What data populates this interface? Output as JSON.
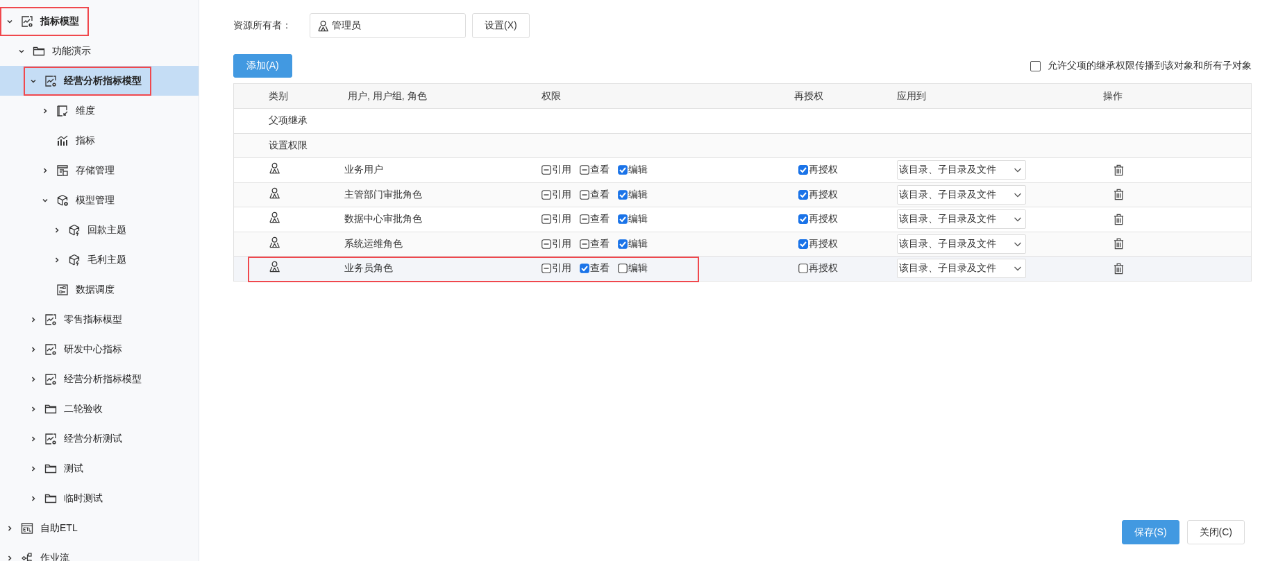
{
  "sidebar": {
    "tree": [
      {
        "label": "指标模型",
        "kind": "model",
        "expanded": true,
        "selected": false,
        "highlighted": true,
        "children": [
          {
            "label": "功能演示",
            "kind": "folder",
            "expanded": true,
            "selected": false,
            "highlighted": false,
            "children": [
              {
                "label": "经营分析指标模型",
                "kind": "model",
                "expanded": true,
                "selected": true,
                "highlighted": true,
                "children": [
                  {
                    "label": "维度",
                    "kind": "dimension",
                    "expanded": false,
                    "selected": false,
                    "highlighted": false
                  },
                  {
                    "label": "指标",
                    "kind": "metric",
                    "selected": false,
                    "highlighted": false
                  },
                  {
                    "label": "存储管理",
                    "kind": "storage",
                    "expanded": false,
                    "selected": false,
                    "highlighted": false
                  },
                  {
                    "label": "模型管理",
                    "kind": "model-manage",
                    "expanded": true,
                    "selected": false,
                    "highlighted": false,
                    "children": [
                      {
                        "label": "回款主题",
                        "kind": "cube",
                        "expanded": false,
                        "selected": false,
                        "highlighted": false
                      },
                      {
                        "label": "毛利主题",
                        "kind": "cube",
                        "expanded": false,
                        "selected": false,
                        "highlighted": false
                      }
                    ]
                  },
                  {
                    "label": "数据调度",
                    "kind": "schedule",
                    "selected": false,
                    "highlighted": false
                  }
                ]
              },
              {
                "label": "零售指标模型",
                "kind": "model",
                "expanded": false,
                "selected": false,
                "highlighted": false
              },
              {
                "label": "研发中心指标",
                "kind": "model",
                "expanded": false,
                "selected": false,
                "highlighted": false
              },
              {
                "label": "经营分析指标模型",
                "kind": "model",
                "expanded": false,
                "selected": false,
                "highlighted": false
              },
              {
                "label": "二轮验收",
                "kind": "folder",
                "expanded": false,
                "selected": false,
                "highlighted": false
              },
              {
                "label": "经营分析测试",
                "kind": "model",
                "expanded": false,
                "selected": false,
                "highlighted": false
              },
              {
                "label": "测试",
                "kind": "folder",
                "expanded": false,
                "selected": false,
                "highlighted": false
              },
              {
                "label": "临时测试",
                "kind": "folder",
                "expanded": false,
                "selected": false,
                "highlighted": false
              }
            ]
          }
        ]
      },
      {
        "label": "自助ETL",
        "kind": "etl",
        "expanded": false,
        "selected": false,
        "highlighted": false
      },
      {
        "label": "作业流",
        "kind": "flow",
        "expanded": false,
        "selected": false,
        "highlighted": false
      }
    ]
  },
  "owner": {
    "label": "资源所有者：",
    "value": "管理员",
    "button": "设置(X)"
  },
  "add_button": "添加(A)",
  "inherit_option": {
    "label": "允许父项的继承权限传播到该对象和所有子对象",
    "checked": false
  },
  "table": {
    "columns": [
      "类别",
      "用户, 用户组, 角色",
      "权限",
      "再授权",
      "应用到",
      "操作"
    ],
    "sections": [
      "父项继承",
      "设置权限"
    ],
    "rows": [
      {
        "user": "业务用户",
        "permissions": [
          {
            "label": "引用",
            "checked": false,
            "indeterminate": true
          },
          {
            "label": "查看",
            "checked": false,
            "indeterminate": true
          },
          {
            "label": "编辑",
            "checked": true,
            "indeterminate": false
          }
        ],
        "regrant": {
          "label": "再授权",
          "checked": true
        },
        "apply_to": "该目录、子目录及文件",
        "highlighted": false
      },
      {
        "user": "主管部门审批角色",
        "permissions": [
          {
            "label": "引用",
            "checked": false,
            "indeterminate": true
          },
          {
            "label": "查看",
            "checked": false,
            "indeterminate": true
          },
          {
            "label": "编辑",
            "checked": true,
            "indeterminate": false
          }
        ],
        "regrant": {
          "label": "再授权",
          "checked": true
        },
        "apply_to": "该目录、子目录及文件",
        "highlighted": false
      },
      {
        "user": "数据中心审批角色",
        "permissions": [
          {
            "label": "引用",
            "checked": false,
            "indeterminate": true
          },
          {
            "label": "查看",
            "checked": false,
            "indeterminate": true
          },
          {
            "label": "编辑",
            "checked": true,
            "indeterminate": false
          }
        ],
        "regrant": {
          "label": "再授权",
          "checked": true
        },
        "apply_to": "该目录、子目录及文件",
        "highlighted": false
      },
      {
        "user": "系统运维角色",
        "permissions": [
          {
            "label": "引用",
            "checked": false,
            "indeterminate": true
          },
          {
            "label": "查看",
            "checked": false,
            "indeterminate": true
          },
          {
            "label": "编辑",
            "checked": true,
            "indeterminate": false
          }
        ],
        "regrant": {
          "label": "再授权",
          "checked": true
        },
        "apply_to": "该目录、子目录及文件",
        "highlighted": false
      },
      {
        "user": "业务员角色",
        "permissions": [
          {
            "label": "引用",
            "checked": false,
            "indeterminate": true
          },
          {
            "label": "查看",
            "checked": true,
            "indeterminate": false
          },
          {
            "label": "编辑",
            "checked": false,
            "indeterminate": false
          }
        ],
        "regrant": {
          "label": "再授权",
          "checked": false
        },
        "apply_to": "该目录、子目录及文件",
        "highlighted": true
      }
    ]
  },
  "footer": {
    "save": "保存(S)",
    "close": "关闭(C)"
  }
}
